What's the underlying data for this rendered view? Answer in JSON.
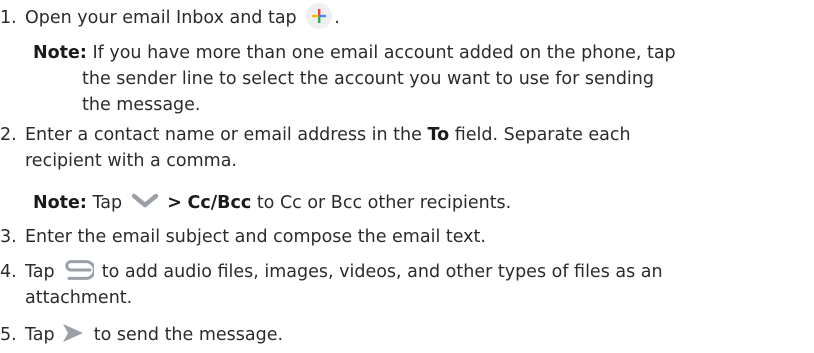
{
  "steps": [
    {
      "number": "1.",
      "before": "Open your email Inbox and tap",
      "icon": "plus-icon",
      "after": "."
    },
    {
      "number": "2.",
      "line1_before": "Enter a contact name or email address in the",
      "line1_bold": "To",
      "line1_after": "field. Separate each",
      "line2": "recipient with a comma."
    },
    {
      "number": "3.",
      "text": "Enter the email subject and compose the email text."
    },
    {
      "number": "4.",
      "before": "Tap",
      "icon": "paperclip-icon",
      "after": "to add audio files, images, videos, and other types of files as an",
      "line2": "attachment."
    },
    {
      "number": "5.",
      "before": "Tap",
      "icon": "send-icon",
      "after": "to send the message."
    }
  ],
  "note1": {
    "label": "Note:",
    "line1": "If you have more than one email account added on the phone, tap",
    "line2": "the sender line to select the account you want to use for sending",
    "line3": "the message."
  },
  "note2": {
    "label": "Note:",
    "before": "Tap",
    "icon": "chevron-down-icon",
    "arrow": ">",
    "bold": "Cc/Bcc",
    "after": "to Cc or Bcc other recipients."
  },
  "colors": {
    "text": "#2b2b2b",
    "icon_gray": "#9aa0a6",
    "plus_blue": "#4285f4",
    "plus_red": "#ea4335",
    "plus_yellow": "#fbbc04",
    "plus_green": "#34a853",
    "plus_bg": "#eef0f3"
  }
}
